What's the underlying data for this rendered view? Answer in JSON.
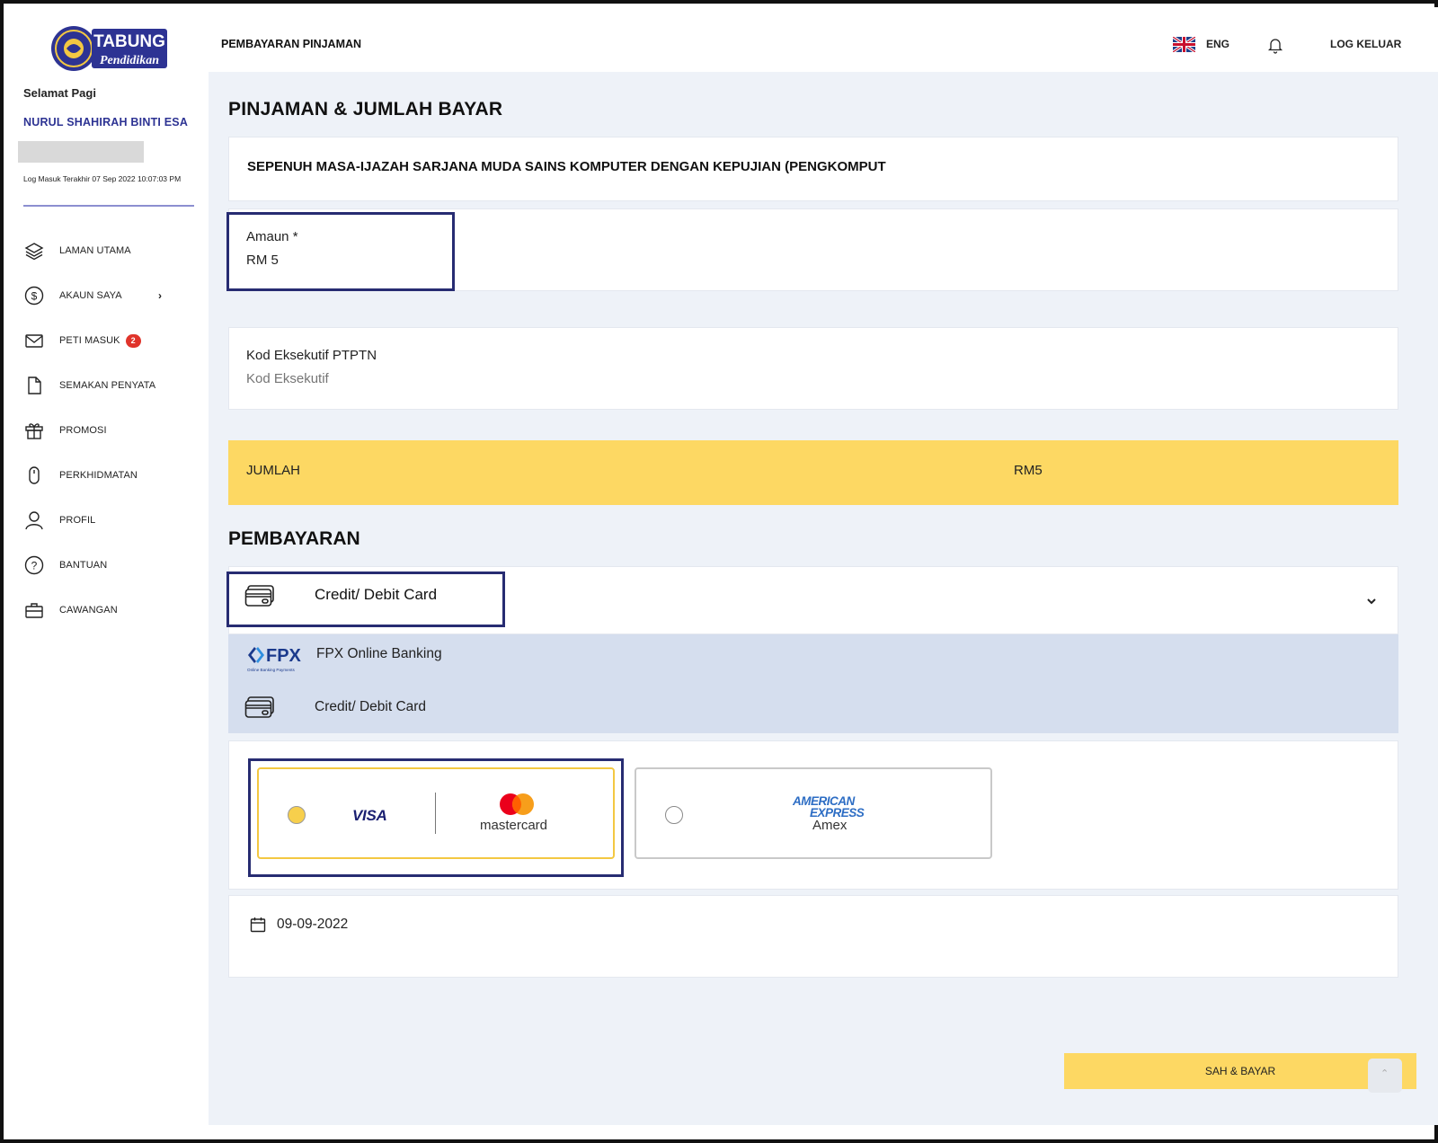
{
  "brand": {
    "logo_word1": "TABUNG",
    "logo_word2": "Pendidikan"
  },
  "topbar": {
    "page_heading": "PEMBAYARAN PINJAMAN",
    "language": "ENG",
    "logout": "LOG KELUAR"
  },
  "sidebar": {
    "greeting": "Selamat Pagi",
    "user_name": "NURUL SHAHIRAH BINTI ESA",
    "last_login": "Log Masuk Terakhir 07 Sep 2022 10:07:03 PM",
    "items": [
      {
        "label": "LAMAN UTAMA",
        "icon": "layers-icon"
      },
      {
        "label": "AKAUN SAYA",
        "icon": "dollar-circle-icon"
      },
      {
        "label": "PETI MASUK",
        "icon": "mail-icon",
        "badge": "2"
      },
      {
        "label": "SEMAKAN PENYATA",
        "icon": "document-icon"
      },
      {
        "label": "PROMOSI",
        "icon": "gift-icon"
      },
      {
        "label": "PERKHIDMATAN",
        "icon": "mouse-icon"
      },
      {
        "label": "PROFIL",
        "icon": "user-icon"
      },
      {
        "label": "BANTUAN",
        "icon": "help-icon"
      },
      {
        "label": "CAWANGAN",
        "icon": "briefcase-icon"
      }
    ]
  },
  "main": {
    "title": "PINJAMAN & JUMLAH BAYAR",
    "course": "SEPENUH MASA-IJAZAH SARJANA MUDA SAINS KOMPUTER DENGAN KEPUJIAN (PENGKOMPUT",
    "amount_label": "Amaun *",
    "amount_value": "RM  5",
    "exec_label": "Kod Eksekutif PTPTN",
    "exec_placeholder": "Kod Eksekutif",
    "total_label": "JUMLAH",
    "total_value": "RM5",
    "payment_title": "PEMBAYARAN",
    "payment_selected": "Credit/ Debit Card",
    "options": [
      {
        "label": "FPX Online Banking",
        "icon": "fpx-logo",
        "logo_text": "FPX",
        "logo_subtext": "Online Banking Payments"
      },
      {
        "label": "Credit/ Debit Card",
        "icon": "credit-card-icon"
      }
    ],
    "card_choices": [
      {
        "brand1": "VISA",
        "brand2": "mastercard",
        "selected": true
      },
      {
        "brand_line1": "AMERICAN",
        "brand_line2": "EXPRESS",
        "label": "Amex",
        "selected": false
      }
    ],
    "date": "09-09-2022",
    "pay_button": "SAH & BAYAR",
    "scroll_top": "⌃"
  },
  "colors": {
    "accent_yellow": "#fdd863",
    "brand_navy": "#2d3393",
    "highlight_border": "#272c72",
    "badge_red": "#e0342b",
    "panel_bg": "#eef2f8",
    "dropdown_bg": "#d5deee"
  }
}
